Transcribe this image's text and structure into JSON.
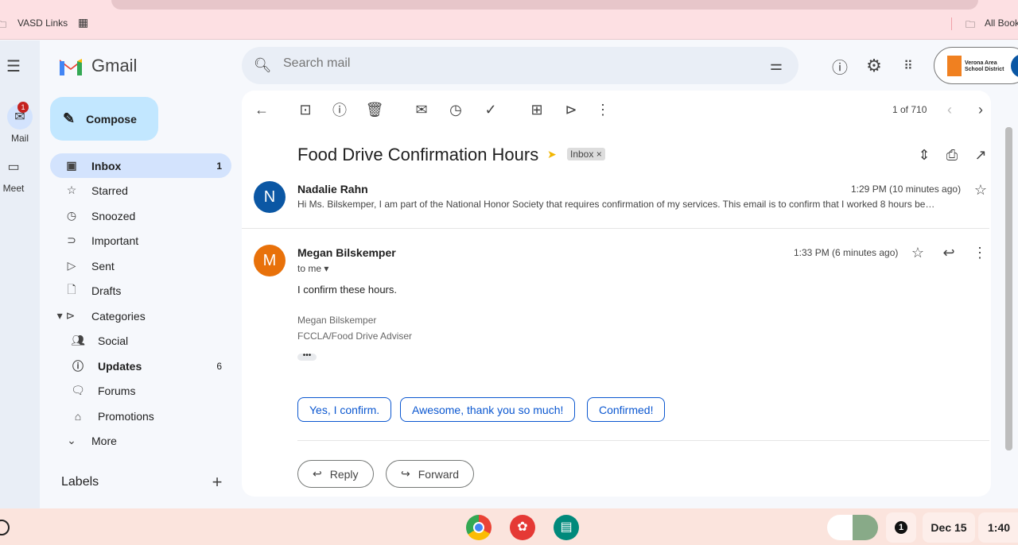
{
  "browser": {
    "bookmark_vasd": "VASD Links",
    "bookmark_all": "All Bookmarks"
  },
  "rail": {
    "mail": "Mail",
    "mail_badge": "1",
    "meet": "Meet"
  },
  "header": {
    "app_name": "Gmail",
    "search_placeholder": "Search mail",
    "org_logo": "Verona Area School District"
  },
  "sidebar": {
    "compose": "Compose",
    "items": [
      {
        "label": "Inbox",
        "count": "1",
        "icon": "inbox-icon"
      },
      {
        "label": "Starred",
        "icon": "star-icon"
      },
      {
        "label": "Snoozed",
        "icon": "clock-icon"
      },
      {
        "label": "Important",
        "icon": "important-icon"
      },
      {
        "label": "Sent",
        "icon": "send-icon"
      },
      {
        "label": "Drafts",
        "icon": "draft-icon"
      },
      {
        "label": "Categories",
        "icon": "label-icon"
      }
    ],
    "categories": [
      {
        "label": "Social",
        "icon": "people-icon"
      },
      {
        "label": "Updates",
        "count": "6",
        "icon": "info-icon"
      },
      {
        "label": "Forums",
        "icon": "forum-icon"
      },
      {
        "label": "Promotions",
        "icon": "tag-icon"
      }
    ],
    "more": "More",
    "labels": "Labels"
  },
  "toolbar": {
    "pagination": "1 of 710"
  },
  "thread": {
    "subject": "Food Drive Confirmation Hours",
    "label": "Inbox",
    "messages": [
      {
        "initial": "N",
        "sender": "Nadalie Rahn",
        "time": "1:29 PM (10 minutes ago)",
        "snippet": "Hi Ms. Bilskemper, I am part of the National Honor Society that requires confirmation of my services. This email is to confirm that I worked 8 hours be…",
        "color": "#0b57a4"
      },
      {
        "initial": "M",
        "sender": "Megan Bilskemper",
        "time": "1:33 PM (6 minutes ago)",
        "to": "to me",
        "body": "I confirm these hours.",
        "sig1": "Megan Bilskemper",
        "sig2": "FCCLA/Food Drive Adviser",
        "color": "#e8710a"
      }
    ],
    "smart_replies": [
      "Yes, I confirm.",
      "Awesome, thank you so much!",
      "Confirmed!"
    ],
    "reply": "Reply",
    "forward": "Forward"
  },
  "taskbar": {
    "notif_count": "1",
    "date": "Dec 15",
    "time": "1:40"
  }
}
